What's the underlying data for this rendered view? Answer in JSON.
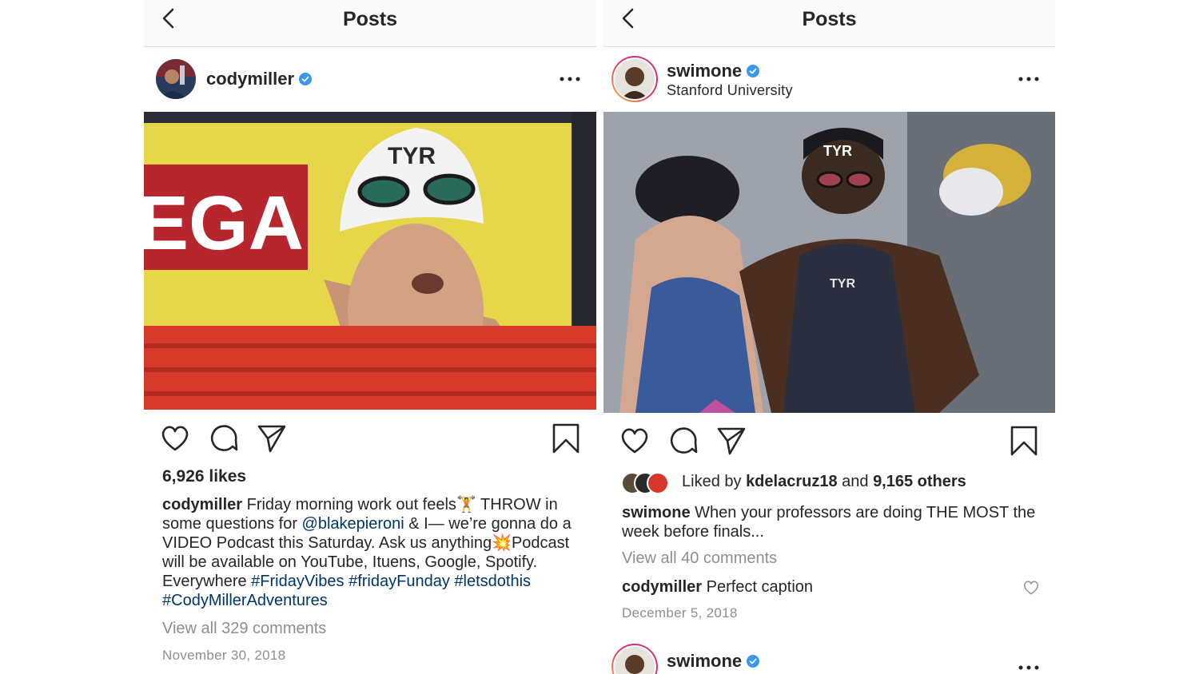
{
  "left_post": {
    "topbar": {
      "title": "Posts"
    },
    "header": {
      "username": "codymiller"
    },
    "photo": {
      "cap_logo": "TYR",
      "banner_text": "EGA"
    },
    "likes": "6,926 likes",
    "caption": {
      "username": "codymiller",
      "t1": " Friday morning work out feels",
      "e1": "🏋",
      "t2": " THROW in some questions for ",
      "mention": "@blakepieroni",
      "t3": " & I— we’re gonna do a VIDEO Podcast this Saturday. Ask us anything",
      "e2": "💥",
      "t4": "Podcast will be available on YouTube, Ituens, Google, Spotify. Everywhere ",
      "tag1": "#FridayVibes",
      "tag2": "#fridayFunday",
      "tag3": "#letsdothis",
      "tag4": "#CodyMillerAdventures"
    },
    "view_comments": "View all 329 comments",
    "date": "November 30, 2018"
  },
  "right_post": {
    "topbar": {
      "title": "Posts"
    },
    "header": {
      "username": "swimone",
      "location": "Stanford University"
    },
    "photo": {
      "cap_logo": "TYR",
      "suit_logo": "TYR"
    },
    "liked_by": {
      "prefix": "Liked by ",
      "user": "kdelacruz18",
      "and": " and ",
      "others": "9,165 others"
    },
    "caption": {
      "username": "swimone",
      "text": " When your professors are doing THE MOST the week before finals..."
    },
    "view_comments": "View all 40 comments",
    "comment": {
      "username": "codymiller",
      "text": " Perfect caption"
    },
    "date": "December 5, 2018",
    "next_post": {
      "username": "swimone"
    }
  },
  "colors": {
    "verified": "#3897f0",
    "link": "#003569",
    "muted": "#8e8e8e",
    "text": "#262626"
  },
  "icons": [
    "back-arrow-icon",
    "verified-badge-icon",
    "more-options-icon",
    "heart-icon",
    "comment-icon",
    "share-icon",
    "bookmark-icon"
  ]
}
